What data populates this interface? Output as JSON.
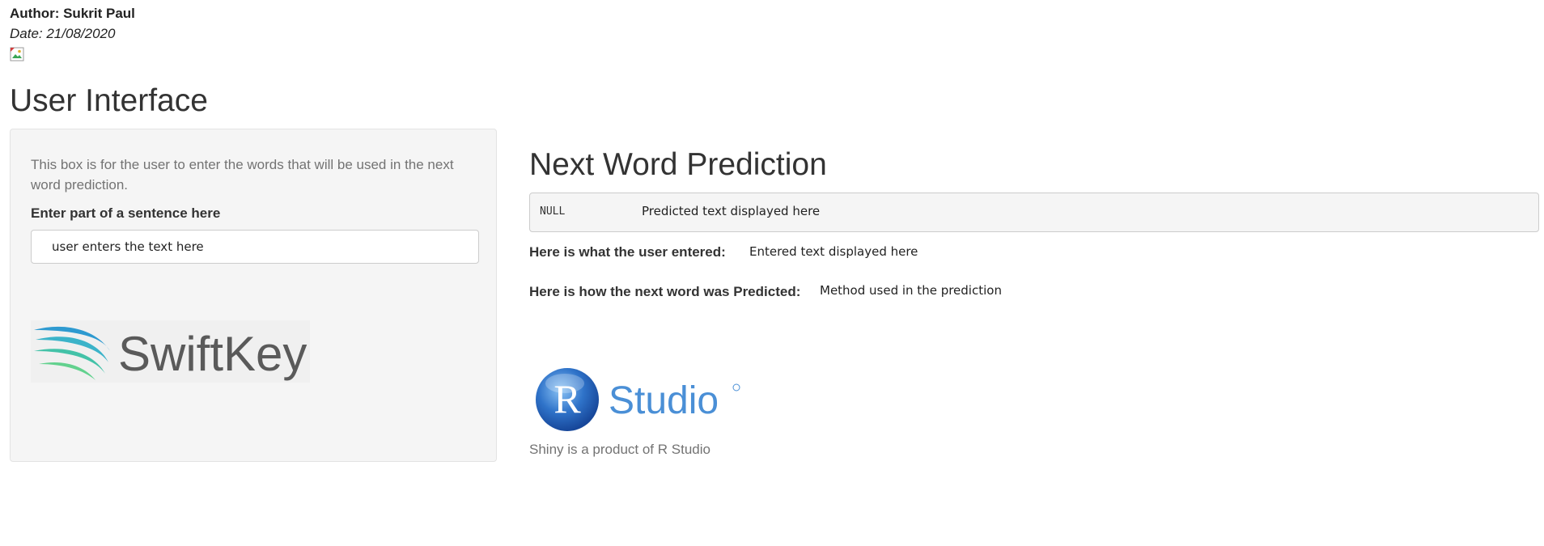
{
  "header": {
    "author": "Author: Sukrit Paul",
    "date": "Date: 21/08/2020"
  },
  "section_title": "User Interface",
  "sidebar": {
    "help_text": "This box is for the user to enter the words that will be used in the next word prediction.",
    "input_label": "Enter part of a sentence here",
    "input_value": "user enters the text here",
    "logo_text": "SwiftKey",
    "logo_icon": "swiftkey-swoosh-icon"
  },
  "main": {
    "title": "Next Word Prediction",
    "prediction_box": {
      "null_text": "NULL",
      "predicted_text": "Predicted text displayed here"
    },
    "entered_label": "Here is what the user entered:",
    "entered_value": "Entered text displayed here",
    "method_label": "Here is how the next word was Predicted:",
    "method_value": "Method used in the prediction",
    "rstudio_logo_text": "Studio",
    "rstudio_logo_letter": "R",
    "caption": "Shiny is a product of R Studio"
  },
  "colors": {
    "well_bg": "#f5f5f5",
    "help_text": "#737373",
    "rstudio_blue": "#4a8fd6",
    "swiftkey_gray": "#5a5a5a"
  }
}
